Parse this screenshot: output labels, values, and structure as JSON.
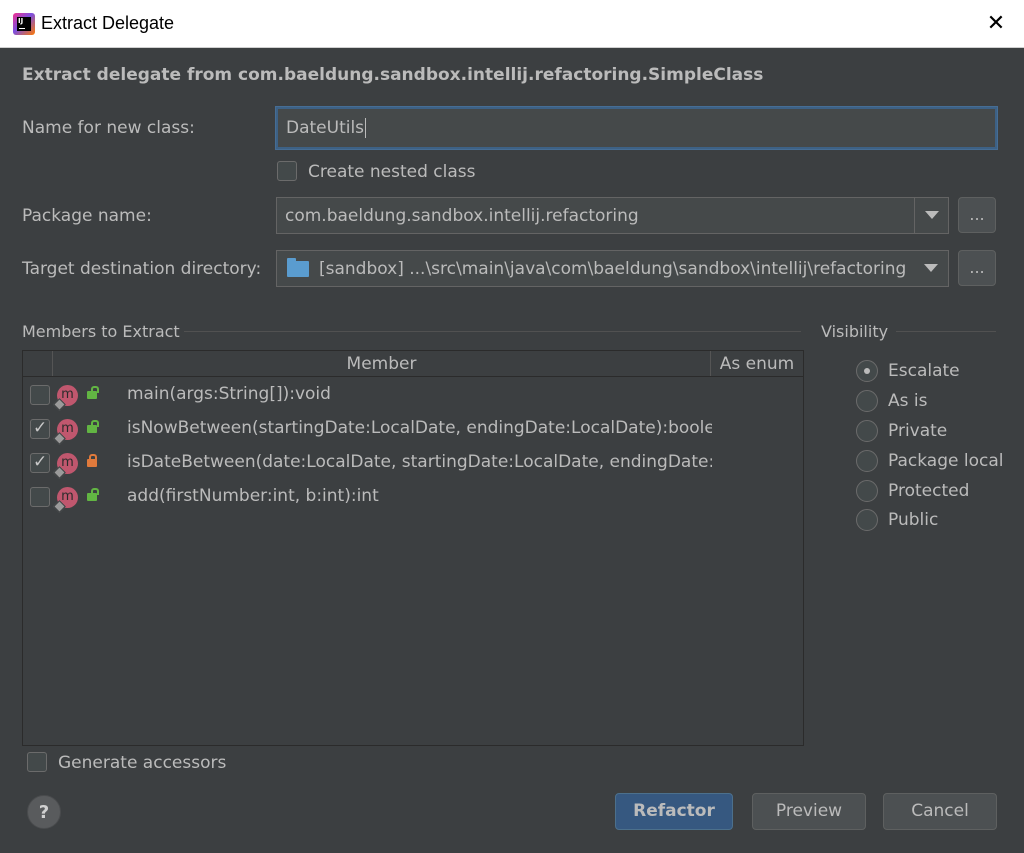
{
  "window": {
    "title": "Extract Delegate",
    "close_glyph": "✕"
  },
  "heading": "Extract delegate from com.baeldung.sandbox.intellij.refactoring.SimpleClass",
  "name_field": {
    "label": "Name for new class:",
    "value": "DateUtils"
  },
  "nested_checkbox": {
    "label": "Create nested class",
    "checked": false
  },
  "package": {
    "label": "Package name:",
    "value": "com.baeldung.sandbox.intellij.refactoring",
    "browse_label": "..."
  },
  "target_dir": {
    "label": "Target destination directory:",
    "value": "[sandbox] ...\\src\\main\\java\\com\\baeldung\\sandbox\\intellij\\refactoring",
    "browse_label": "..."
  },
  "members": {
    "section_title": "Members to Extract",
    "columns": [
      "Member",
      "As enum"
    ],
    "rows": [
      {
        "checked": false,
        "icon": "method-icon",
        "access": "public",
        "text": "main(args:String[]):void"
      },
      {
        "checked": true,
        "icon": "method-icon",
        "access": "public",
        "text": "isNowBetween(startingDate:LocalDate, endingDate:LocalDate):boolean"
      },
      {
        "checked": true,
        "icon": "method-icon",
        "access": "private",
        "text": "isDateBetween(date:LocalDate, startingDate:LocalDate, endingDate:LocalDate):boolean"
      },
      {
        "checked": false,
        "icon": "method-icon",
        "access": "public",
        "text": "add(firstNumber:int, b:int):int"
      }
    ]
  },
  "visibility": {
    "section_title": "Visibility",
    "options": [
      {
        "label": "Escalate",
        "selected": true
      },
      {
        "label": "As is",
        "selected": false
      },
      {
        "label": "Private",
        "selected": false
      },
      {
        "label": "Package local",
        "selected": false
      },
      {
        "label": "Protected",
        "selected": false
      },
      {
        "label": "Public",
        "selected": false
      }
    ]
  },
  "generate_accessors": {
    "label": "Generate accessors",
    "checked": false
  },
  "buttons": {
    "help": "?",
    "refactor": "Refactor",
    "preview": "Preview",
    "cancel": "Cancel"
  },
  "colors": {
    "background": "#3c3f41",
    "text": "#bbbbbb",
    "primary_button": "#365880",
    "method_icon": "#c0576e",
    "public_lock": "#62b543",
    "private_lock": "#e07a3c",
    "folder": "#5a9ccf"
  }
}
